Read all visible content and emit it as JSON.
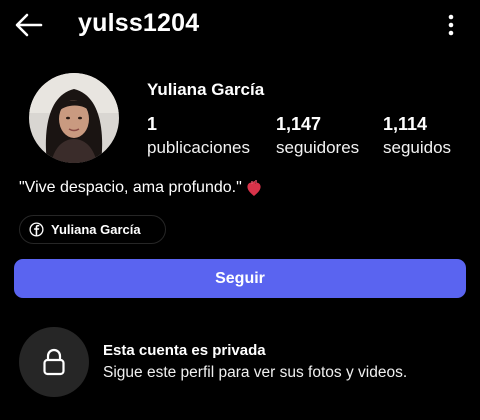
{
  "header": {
    "username": "yulss1204",
    "back_icon": "arrow-left-icon",
    "menu_icon": "more-vertical-icon"
  },
  "profile": {
    "display_name": "Yuliana García",
    "stats": {
      "posts": {
        "count": "1",
        "label": "publicaciones"
      },
      "followers": {
        "count": "1,147",
        "label": "seguidores"
      },
      "following": {
        "count": "1,114",
        "label": "seguidos"
      }
    },
    "bio": "\"Vive despacio, ama profundo.\"",
    "bio_emoji_icon": "anatomical-heart-icon",
    "linked_account": {
      "icon": "facebook-icon",
      "label": "Yuliana García"
    }
  },
  "actions": {
    "follow_label": "Seguir"
  },
  "private_notice": {
    "icon": "lock-icon",
    "title": "Esta cuenta es privada",
    "subtitle": "Sigue este perfil para ver sus fotos y videos."
  },
  "colors": {
    "background": "#000000",
    "primary_button": "#5a64f0",
    "chip_border": "#262626",
    "lock_circle": "#262626"
  }
}
